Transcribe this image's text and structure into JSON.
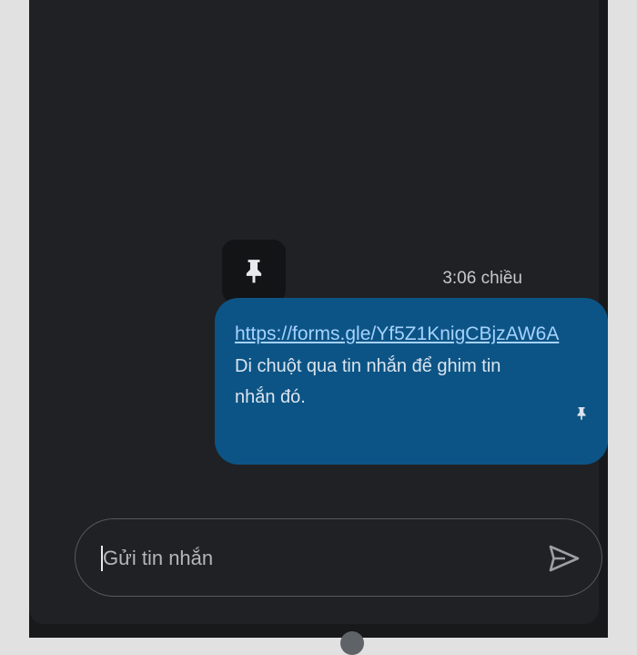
{
  "message": {
    "timestamp": "3:06 chiều",
    "link_text": "https://forms.gle/Yf5Z1KnigCBjzAW6A",
    "hint": "Di chuột qua tin nhắn để ghim tin nhắn đó."
  },
  "composer": {
    "placeholder": "Gửi tin nhắn"
  },
  "icons": {
    "tooltip": "pin-icon",
    "bubble": "pin-icon",
    "send": "send-icon"
  },
  "colors": {
    "background": "#202124",
    "bubble": "#0c5485",
    "link": "#a5d2ff"
  }
}
